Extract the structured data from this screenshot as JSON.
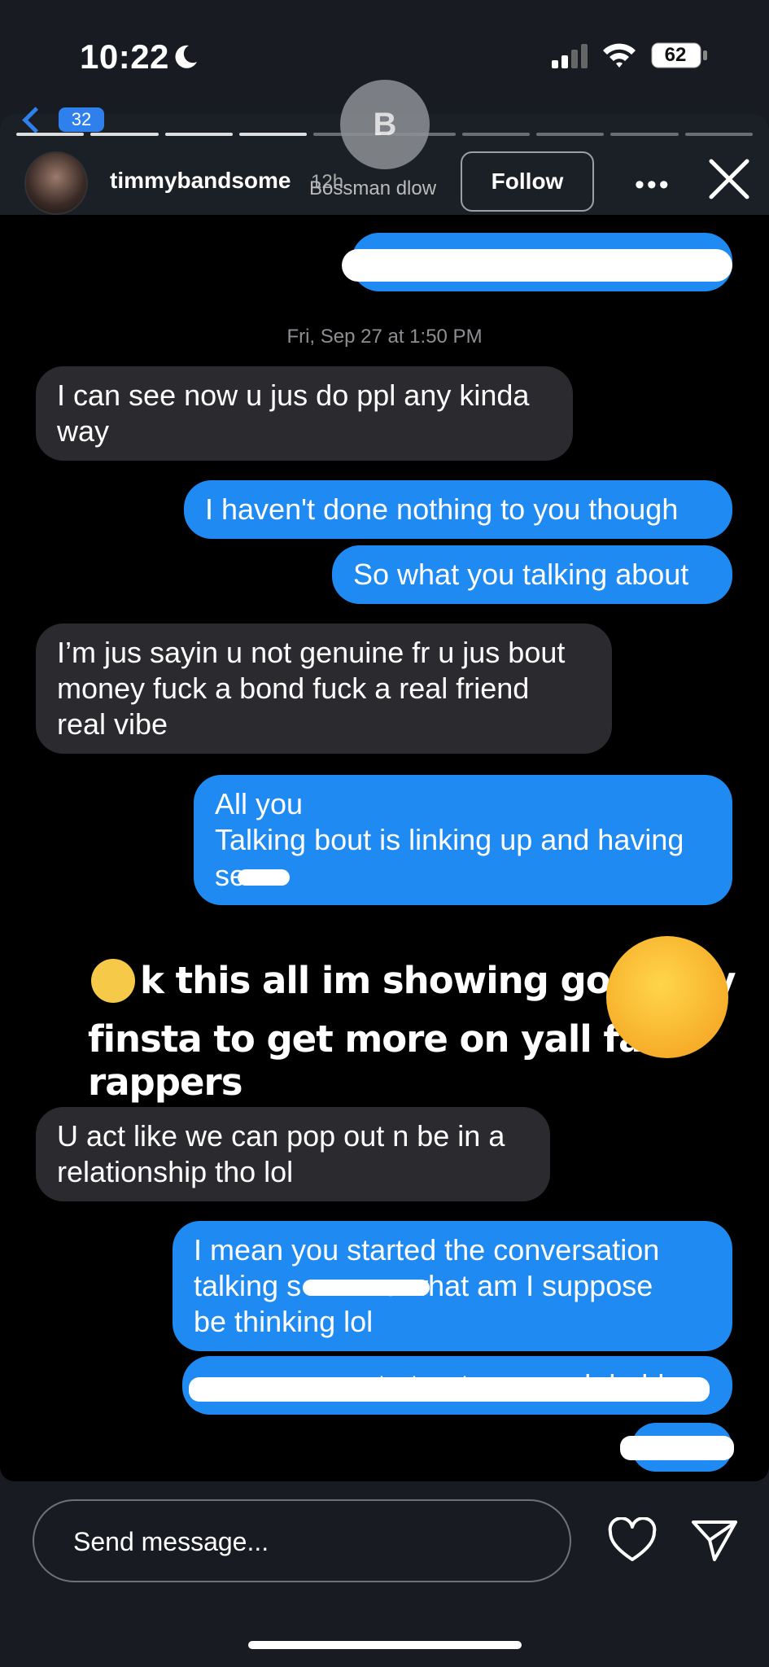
{
  "status_bar": {
    "time": "10:22",
    "battery": "62"
  },
  "story": {
    "username": "timmybandsome",
    "age": "12h",
    "follow_label": "Follow",
    "back_badge": "32",
    "thread_avatar_letter": "B",
    "thread_name": "Bossman dlow"
  },
  "conversation": {
    "timestamp": "Fri, Sep 27 at 1:50 PM",
    "messages": [
      {
        "from": "them",
        "text": "I can see now u jus do ppl any kinda\nway"
      },
      {
        "from": "me",
        "text": "I haven't done nothing to you though"
      },
      {
        "from": "me",
        "text": "So what you talking about"
      },
      {
        "from": "them",
        "text": "I’m jus sayin u not genuine fr u jus bout\nmoney fuck a bond fuck a real friend\nreal vibe"
      },
      {
        "from": "me",
        "text": "All you\nTalking bout is linking up and having\nse"
      },
      {
        "from": "them",
        "text": "U act like we can pop out n be in a\nrelationship tho lol"
      },
      {
        "from": "me",
        "text": "I mean you started the conversation\ntalking s          o what am I suppose\nbe thinking lol"
      },
      {
        "from": "me",
        "text": "you suppose to treat me good daddy"
      }
    ]
  },
  "overlay": {
    "line1": "k this all im showing go to my",
    "line2": "finsta to get more on yall fav rappers"
  },
  "composer": {
    "placeholder": "Send message..."
  },
  "icons": [
    "moon-icon",
    "signal-icon",
    "wifi-icon",
    "battery-icon",
    "more-icon",
    "close-icon",
    "heart-icon",
    "send-icon",
    "face-with-hand-over-mouth-emoji",
    "face-with-raised-eyebrow-emoji"
  ]
}
